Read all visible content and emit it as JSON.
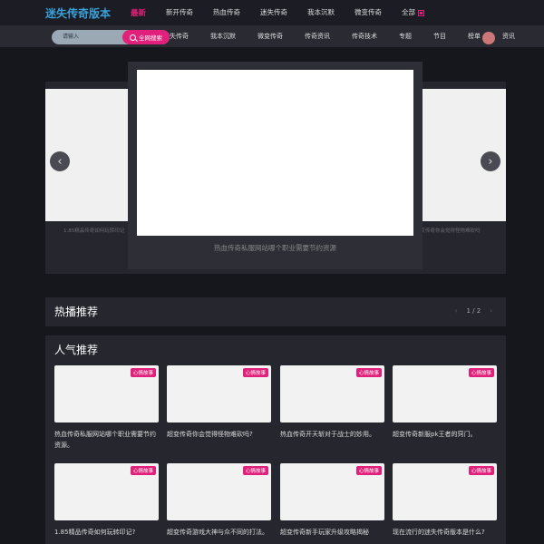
{
  "header": {
    "logo": "迷失传奇版本",
    "nav": [
      "最新",
      "新开传奇",
      "热血传奇",
      "迷失传奇",
      "我本沉默",
      "微变传奇",
      "全部"
    ]
  },
  "subheader": {
    "search_placeholder": "请输入",
    "search_button": "全网搜索",
    "nav": [
      "迷失传奇",
      "我本沉默",
      "微变传奇",
      "传奇资讯",
      "传奇技术",
      "专题",
      "节目",
      "榜单",
      "资讯"
    ]
  },
  "slider": {
    "main_caption": "热血传奇私服网站哪个职业需要节约资源",
    "left_caption": "1.85精品传奇如何玩转印记",
    "right_caption": "超变传奇你会觉得怪物难砍吗"
  },
  "hot": {
    "title": "热播推荐",
    "pager": "1 / 2"
  },
  "popular": {
    "title": "人气推荐",
    "tag": "心情故事",
    "cards": [
      {
        "title": "热血传奇私服网站哪个职业需要节约资源。"
      },
      {
        "title": "超变传奇你会觉得怪物难砍吗?"
      },
      {
        "title": "热血传奇开天斩对于战士的妙用。"
      },
      {
        "title": "超变传奇新服pk王者的窍门。"
      },
      {
        "title": "1.85精品传奇如何玩转印记?"
      },
      {
        "title": "超变传奇游戏大神与众不同的打法。"
      },
      {
        "title": "超变传奇新手玩家升级攻略揭秘"
      },
      {
        "title": "现在流行的迷失传奇版本是什么?"
      }
    ]
  },
  "colors": {
    "accent": "#e0207a",
    "logo": "#3aa0d8",
    "background": "#16161d",
    "panel": "#26262e"
  }
}
